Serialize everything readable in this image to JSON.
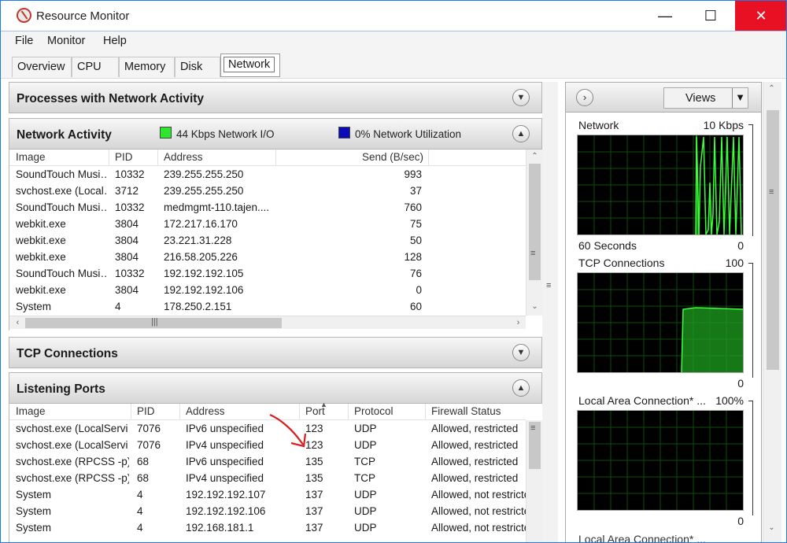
{
  "window": {
    "title": "Resource Monitor",
    "min": "—",
    "max": "☐",
    "close": "✕"
  },
  "menu": {
    "file": "File",
    "monitor": "Monitor",
    "help": "Help"
  },
  "tabs": [
    {
      "label": "Overview"
    },
    {
      "label": "CPU"
    },
    {
      "label": "Memory"
    },
    {
      "label": "Disk"
    },
    {
      "label": "Network",
      "active": true
    }
  ],
  "processes_section": {
    "title": "Processes with Network Activity"
  },
  "network_activity": {
    "title": "Network Activity",
    "legend_io": "44 Kbps Network I/O",
    "legend_util": "0% Network Utilization",
    "colors": {
      "io": "#2ee62e",
      "util": "#0b0bb8"
    },
    "columns": [
      "Image",
      "PID",
      "Address",
      "Send (B/sec)"
    ],
    "rows": [
      [
        "SoundTouch Musi…",
        "10332",
        "239.255.255.250",
        "993"
      ],
      [
        "svchost.exe (Local…",
        "3712",
        "239.255.255.250",
        "37"
      ],
      [
        "SoundTouch Musi…",
        "10332",
        "medmgmt-110.tajen....",
        "760"
      ],
      [
        "webkit.exe",
        "3804",
        "172.217.16.170",
        "75"
      ],
      [
        "webkit.exe",
        "3804",
        "23.221.31.228",
        "50"
      ],
      [
        "webkit.exe",
        "3804",
        "216.58.205.226",
        "128"
      ],
      [
        "SoundTouch Musi…",
        "10332",
        "192.192.192.105",
        "76"
      ],
      [
        "webkit.exe",
        "3804",
        "192.192.192.106",
        "0"
      ],
      [
        "System",
        "4",
        "178.250.2.151",
        "60"
      ]
    ]
  },
  "tcp_section": {
    "title": "TCP Connections"
  },
  "listening_ports": {
    "title": "Listening Ports",
    "columns": [
      "Image",
      "PID",
      "Address",
      "Port",
      "Protocol",
      "Firewall Status"
    ],
    "rows": [
      [
        "svchost.exe (LocalServi…",
        "7076",
        "IPv6 unspecified",
        "123",
        "UDP",
        "Allowed, restricted"
      ],
      [
        "svchost.exe (LocalServi…",
        "7076",
        "IPv4 unspecified",
        "123",
        "UDP",
        "Allowed, restricted"
      ],
      [
        "svchost.exe (RPCSS -p)",
        "68",
        "IPv6 unspecified",
        "135",
        "TCP",
        "Allowed, restricted"
      ],
      [
        "svchost.exe (RPCSS -p)",
        "68",
        "IPv4 unspecified",
        "135",
        "TCP",
        "Allowed, restricted"
      ],
      [
        "System",
        "4",
        "192.192.192.107",
        "137",
        "UDP",
        "Allowed, not restricte"
      ],
      [
        "System",
        "4",
        "192.192.192.106",
        "137",
        "UDP",
        "Allowed, not restricte"
      ],
      [
        "System",
        "4",
        "192.168.181.1",
        "137",
        "UDP",
        "Allowed, not restricte"
      ]
    ]
  },
  "right_panel": {
    "views_label": "Views",
    "graphs": [
      {
        "label": "Network",
        "max": "10 Kbps",
        "footer": "60 Seconds",
        "min": "0"
      },
      {
        "label": "TCP Connections",
        "max": "100",
        "footer": "",
        "min": "0"
      },
      {
        "label": "Local Area Connection* ...",
        "max": "100%",
        "footer": "",
        "min": "0"
      },
      {
        "label": "Local Area Connection* ...",
        "max": "",
        "footer": "",
        "min": ""
      }
    ]
  }
}
